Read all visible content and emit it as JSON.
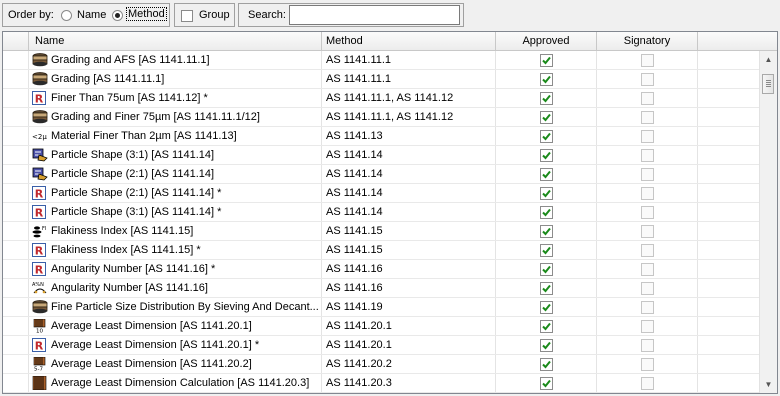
{
  "toolbar": {
    "order_by_label": "Order by:",
    "order_options": [
      {
        "label": "Name",
        "selected": false
      },
      {
        "label": "Method",
        "selected": true
      }
    ],
    "group_label": "Group",
    "group_checked": false,
    "search_label": "Search:",
    "search_value": ""
  },
  "table": {
    "columns": [
      "",
      "Name",
      "Method",
      "Approved",
      "Signatory",
      ""
    ],
    "rows": [
      {
        "icon": "sieve-grading-icon",
        "name": "Grading and AFS [AS 1141.11.1]",
        "method": "AS 1141.11.1",
        "approved": true,
        "signatory": false
      },
      {
        "icon": "sieve-grading-icon",
        "name": "Grading [AS 1141.11.1]",
        "method": "AS 1141.11.1",
        "approved": true,
        "signatory": false
      },
      {
        "icon": "report-r-icon",
        "name": "Finer Than 75um [AS 1141.12] *",
        "method": "AS 1141.11.1, AS 1141.12",
        "approved": true,
        "signatory": false
      },
      {
        "icon": "sieve-grading-icon",
        "name": "Grading and Finer 75µm [AS 1141.11.1/12]",
        "method": "AS 1141.11.1, AS 1141.12",
        "approved": true,
        "signatory": false
      },
      {
        "icon": "fines-2um-icon",
        "name": "Material Finer Than 2µm [AS 1141.13]",
        "method": "AS 1141.13",
        "approved": true,
        "signatory": false
      },
      {
        "icon": "particle-shape-icon",
        "name": "Particle Shape (3:1) [AS 1141.14]",
        "method": "AS 1141.14",
        "approved": true,
        "signatory": false
      },
      {
        "icon": "particle-shape-icon",
        "name": "Particle Shape (2:1) [AS 1141.14]",
        "method": "AS 1141.14",
        "approved": true,
        "signatory": false
      },
      {
        "icon": "report-r-icon",
        "name": "Particle Shape (2:1) [AS 1141.14] *",
        "method": "AS 1141.14",
        "approved": true,
        "signatory": false
      },
      {
        "icon": "report-r-icon",
        "name": "Particle Shape (3:1) [AS 1141.14] *",
        "method": "AS 1141.14",
        "approved": true,
        "signatory": false
      },
      {
        "icon": "flakiness-icon",
        "name": "Flakiness Index [AS 1141.15]",
        "method": "AS 1141.15",
        "approved": true,
        "signatory": false
      },
      {
        "icon": "report-r-icon",
        "name": "Flakiness Index [AS 1141.15] *",
        "method": "AS 1141.15",
        "approved": true,
        "signatory": false
      },
      {
        "icon": "report-r-icon",
        "name": "Angularity Number [AS 1141.16] *",
        "method": "AS 1141.16",
        "approved": true,
        "signatory": false
      },
      {
        "icon": "angularity-icon",
        "name": "Angularity Number [AS 1141.16]",
        "method": "AS 1141.16",
        "approved": true,
        "signatory": false
      },
      {
        "icon": "sieve-grading-icon",
        "name": "Fine Particle Size Distribution By Sieving And Decant...",
        "method": "AS 1141.19",
        "approved": true,
        "signatory": false
      },
      {
        "icon": "least-dimension-10-icon",
        "name": "Average Least Dimension [AS 1141.20.1]",
        "method": "AS 1141.20.1",
        "approved": true,
        "signatory": false
      },
      {
        "icon": "report-r-icon",
        "name": "Average Least Dimension [AS 1141.20.1] *",
        "method": "AS 1141.20.1",
        "approved": true,
        "signatory": false
      },
      {
        "icon": "least-dimension-57-icon",
        "name": "Average Least Dimension [AS 1141.20.2]",
        "method": "AS 1141.20.2",
        "approved": true,
        "signatory": false
      },
      {
        "icon": "least-dimension-calc-icon",
        "name": "Average Least Dimension Calculation [AS 1141.20.3]",
        "method": "AS 1141.20.3",
        "approved": true,
        "signatory": false
      }
    ]
  },
  "colors": {
    "check_green": "#1a8a1a",
    "report_red": "#c0282d",
    "report_blue": "#3a5fa8"
  }
}
